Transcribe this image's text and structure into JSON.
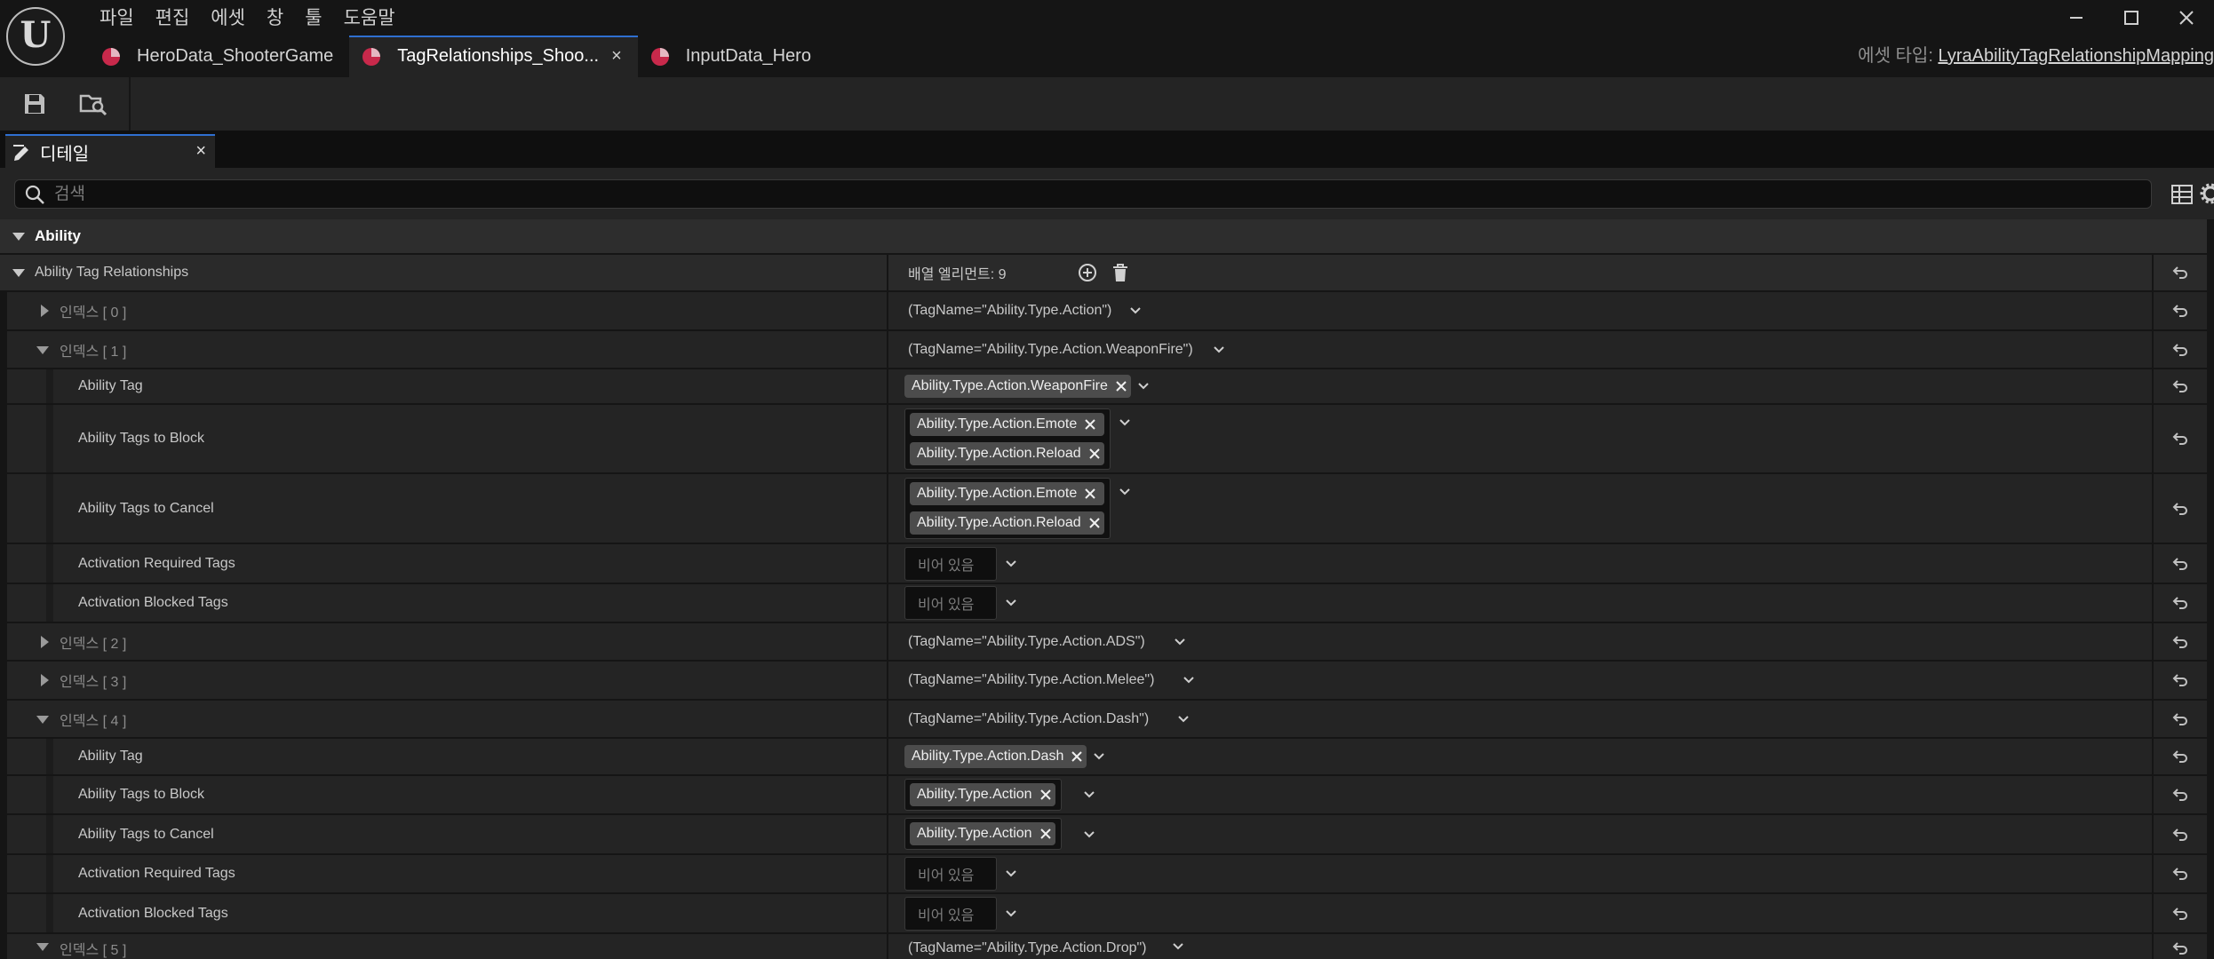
{
  "menubar": [
    "파일",
    "편집",
    "에셋",
    "창",
    "툴",
    "도움말"
  ],
  "tabs": [
    {
      "label": "HeroData_ShooterGame",
      "active": false
    },
    {
      "label": "TagRelationships_Shoo...",
      "active": true
    },
    {
      "label": "InputData_Hero",
      "active": false
    }
  ],
  "tab_close": "×",
  "asset_type": {
    "label": "에셋 타입:",
    "value": "LyraAbilityTagRelationshipMapping"
  },
  "panel": {
    "title": "디테일",
    "close": "×"
  },
  "search": {
    "placeholder": "검색"
  },
  "colors": {
    "accent": "#2f6fd0",
    "asset_icon": "#c8294b",
    "tag_chip": "#4c4c4c"
  },
  "category": "Ability",
  "array": {
    "label": "Ability Tag Relationships",
    "count_label": "배열 엘리먼트: 9"
  },
  "fields": {
    "ability_tag": "Ability Tag",
    "tags_to_block": "Ability Tags to Block",
    "tags_to_cancel": "Ability Tags to Cancel",
    "activation_required": "Activation Required Tags",
    "activation_blocked": "Activation Blocked Tags",
    "empty": "비어 있음"
  },
  "entries": [
    {
      "index": "인덱스 [ 0 ]",
      "summary": "(TagName=\"Ability.Type.Action\")",
      "expanded": false
    },
    {
      "index": "인덱스 [ 1 ]",
      "summary": "(TagName=\"Ability.Type.Action.WeaponFire\")",
      "expanded": true,
      "ability_tag": "Ability.Type.Action.WeaponFire",
      "block": [
        "Ability.Type.Action.Emote",
        "Ability.Type.Action.Reload"
      ],
      "cancel": [
        "Ability.Type.Action.Emote",
        "Ability.Type.Action.Reload"
      ]
    },
    {
      "index": "인덱스 [ 2 ]",
      "summary": "(TagName=\"Ability.Type.Action.ADS\")",
      "expanded": false
    },
    {
      "index": "인덱스 [ 3 ]",
      "summary": "(TagName=\"Ability.Type.Action.Melee\")",
      "expanded": false
    },
    {
      "index": "인덱스 [ 4 ]",
      "summary": "(TagName=\"Ability.Type.Action.Dash\")",
      "expanded": true,
      "ability_tag": "Ability.Type.Action.Dash",
      "block": [
        "Ability.Type.Action"
      ],
      "cancel": [
        "Ability.Type.Action"
      ]
    },
    {
      "index": "인덱스 [ 5 ]",
      "summary": "(TagName=\"Ability.Type.Action.Drop\")",
      "expanded": true
    }
  ]
}
